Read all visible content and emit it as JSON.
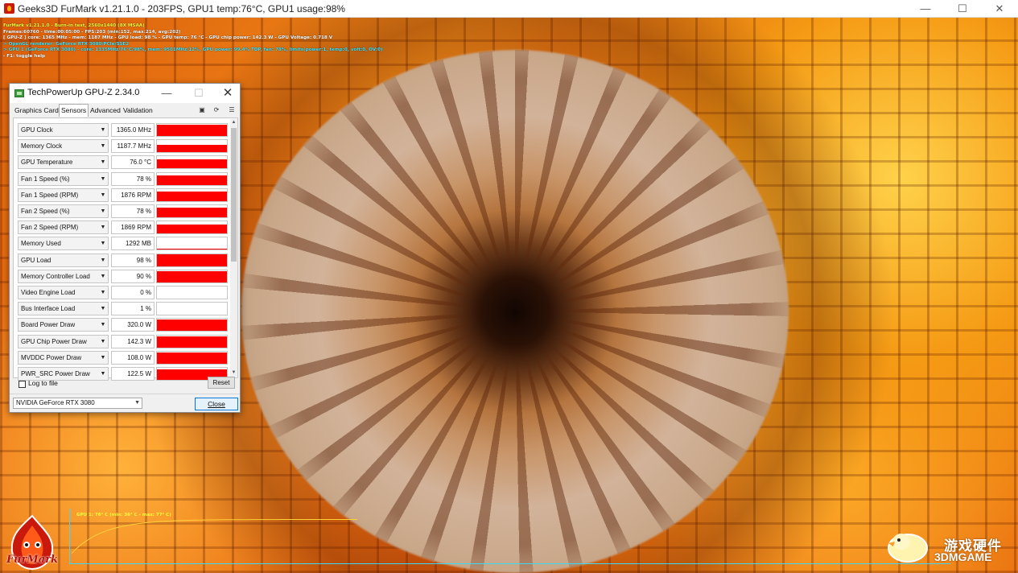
{
  "app": {
    "title": "Geeks3D FurMark v1.21.1.0 - 203FPS, GPU1 temp:76°C, GPU1 usage:98%",
    "window_controls": {
      "minimize": "—",
      "maximize": "☐",
      "close": "✕"
    }
  },
  "osd": {
    "line1": "FurMark v1.21.1.0 - Burn-in test, 2560x1440 (8X MSAA)",
    "line2": "Frames:60760 - time:00:05:00 - FPS:203 (min:152, max:214, avg:202)",
    "line3": "[ GPU-Z ] core: 1365 MHz - mem: 1187 MHz - GPU load: 98 % - GPU temp: 76 °C - GPU chip power: 142.3 W - GPU Voltage: 0.718 V",
    "line4": "> OpenGL renderer: GeForce RTX 3080/PCIe/SSE2",
    "line5": "> GPU 1 (GeForce RTX 3080) - core: 1335MHz/76°C/98%, mem: 9501MHz/12%, GPU power: 99.4% TDP, fan: 78%, limits(power:1, temp:0, volt:0, OV:0)",
    "line6": "- F1: toggle help"
  },
  "temp_graph": {
    "label": "GPU 1: 76° C (min: 36° C - max: 77° C)",
    "min_c": 36,
    "max_c": 77,
    "current_c": 76
  },
  "logo": {
    "text": "FurMark"
  },
  "watermark": {
    "cn": "游戏硬件",
    "en": "3DMGAME"
  },
  "gpuz": {
    "title": "TechPowerUp GPU-Z 2.34.0",
    "window_controls": {
      "minimize": "—",
      "maximize": "☐",
      "close": "✕"
    },
    "tabs": [
      {
        "label": "Graphics Card"
      },
      {
        "label": "Sensors"
      },
      {
        "label": "Advanced"
      },
      {
        "label": "Validation"
      }
    ],
    "active_tab": "Sensors",
    "sensors": [
      {
        "name": "GPU Clock",
        "value": "1365.0 MHz",
        "level": 0.93
      },
      {
        "name": "Memory Clock",
        "value": "1187.7 MHz",
        "level": 0.62
      },
      {
        "name": "GPU Temperature",
        "value": "76.0 °C",
        "level": 0.78
      },
      {
        "name": "Fan 1 Speed (%)",
        "value": "78 %",
        "level": 0.78
      },
      {
        "name": "Fan 1 Speed (RPM)",
        "value": "1876 RPM",
        "level": 0.78
      },
      {
        "name": "Fan 2 Speed (%)",
        "value": "78 %",
        "level": 0.78
      },
      {
        "name": "Fan 2 Speed (RPM)",
        "value": "1869 RPM",
        "level": 0.78
      },
      {
        "name": "Memory Used",
        "value": "1292 MB",
        "level": 0.12
      },
      {
        "name": "GPU Load",
        "value": "98 %",
        "level": 0.98
      },
      {
        "name": "Memory Controller Load",
        "value": "90 %",
        "level": 0.9
      },
      {
        "name": "Video Engine Load",
        "value": "0 %",
        "level": 0.0
      },
      {
        "name": "Bus Interface Load",
        "value": "1 %",
        "level": 0.02
      },
      {
        "name": "Board Power Draw",
        "value": "320.0 W",
        "level": 0.95
      },
      {
        "name": "GPU Chip Power Draw",
        "value": "142.3 W",
        "level": 0.88
      },
      {
        "name": "MVDDC Power Draw",
        "value": "108.0 W",
        "level": 0.9
      },
      {
        "name": "PWR_SRC Power Draw",
        "value": "122.5 W",
        "level": 0.9
      }
    ],
    "log_to_file_label": "Log to file",
    "reset_label": "Reset",
    "gpu_select": "NVIDIA GeForce RTX 3080",
    "close_label": "Close",
    "fill_color": "#ff0000"
  }
}
